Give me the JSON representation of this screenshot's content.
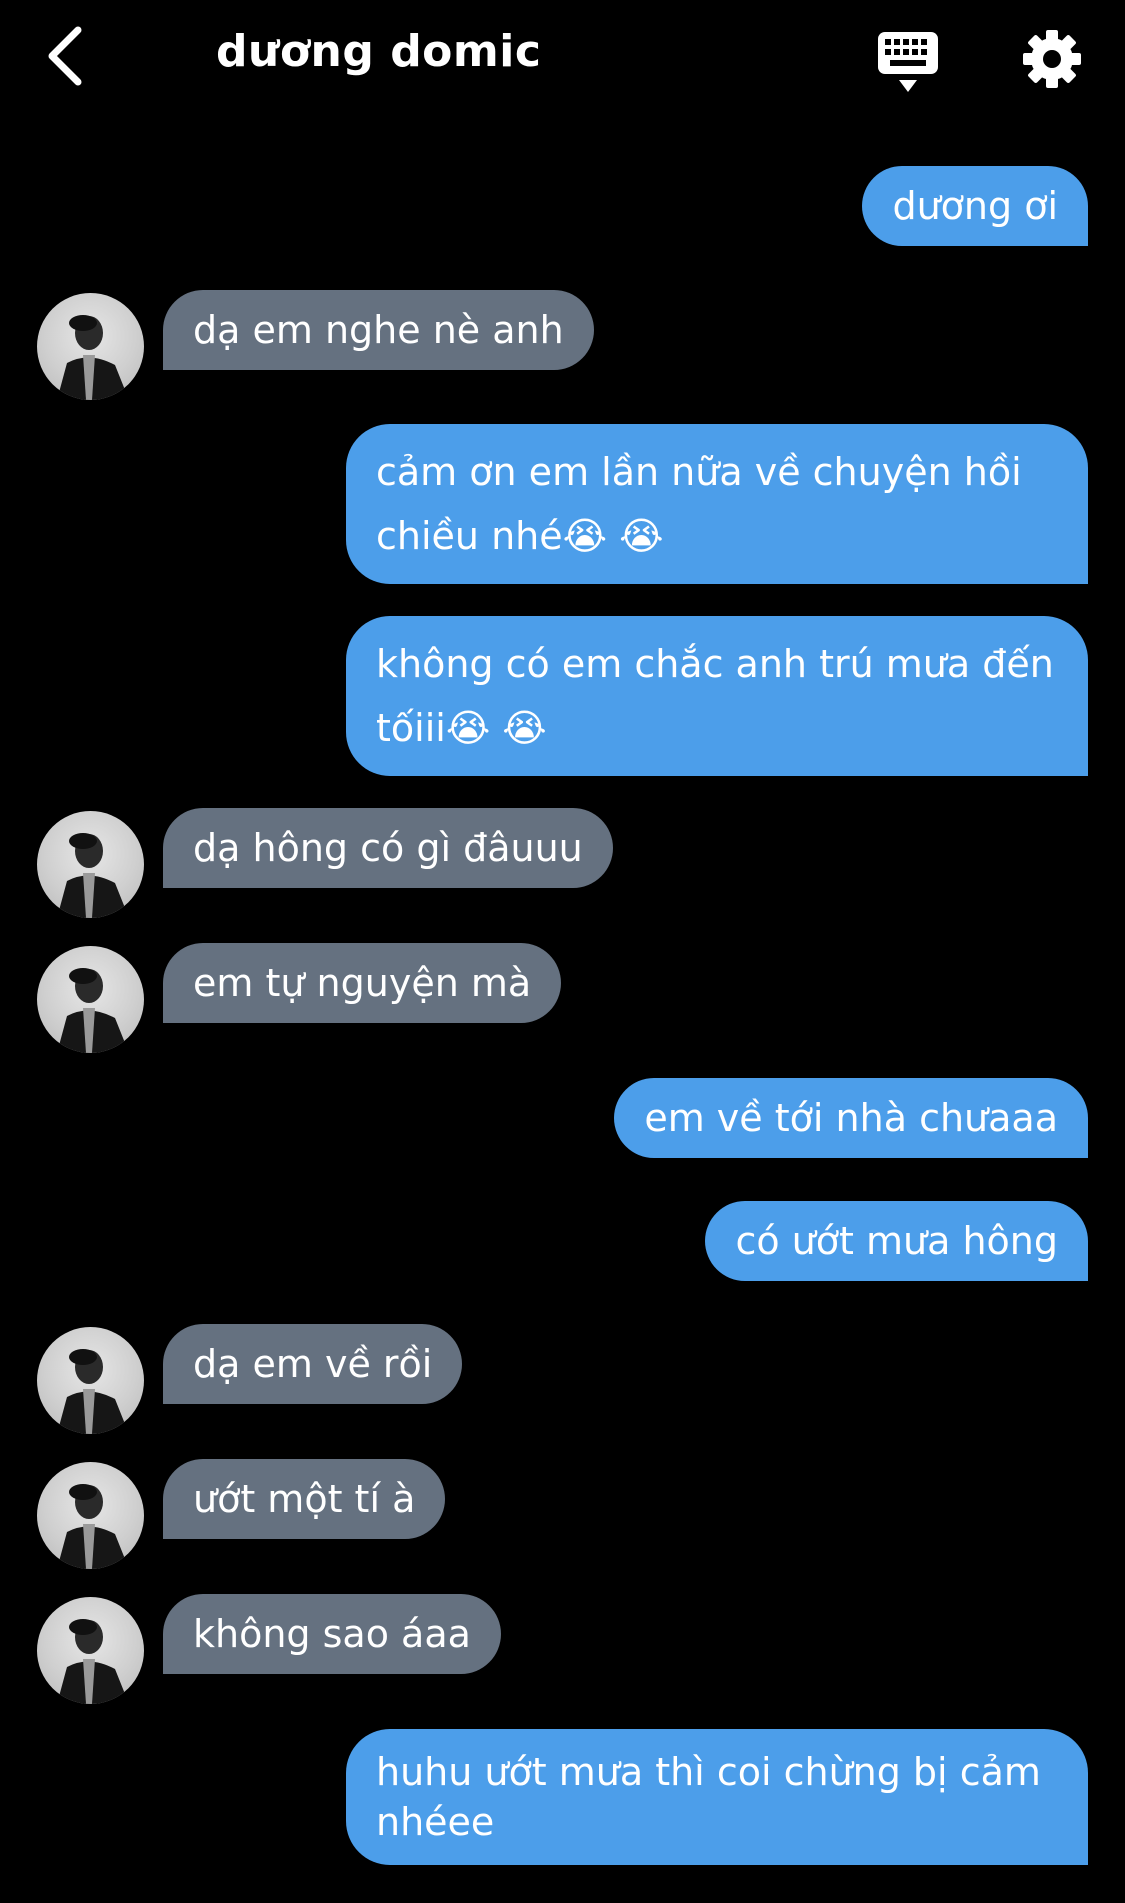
{
  "header": {
    "title": "dương domic",
    "back_icon": "chevron-left-icon",
    "keyboard_icon": "keyboard-icon",
    "settings_icon": "gear-icon"
  },
  "colors": {
    "background": "#000000",
    "sent_bubble": "#4c9eea",
    "received_bubble": "#657180"
  },
  "messages": [
    {
      "from": "me",
      "text": "dương ơi"
    },
    {
      "from": "them",
      "text": "dạ em nghe nè anh"
    },
    {
      "from": "me",
      "text": "cảm ơn em lần nữa về chuyện hồi chiều nhé😭 😭"
    },
    {
      "from": "me",
      "text": "không có em chắc anh trú mưa đến tốiii😭 😭"
    },
    {
      "from": "them",
      "text": "dạ hông có gì đâuuu"
    },
    {
      "from": "them",
      "text": "em tự nguyện mà"
    },
    {
      "from": "me",
      "text": "em về tới nhà chưaaa"
    },
    {
      "from": "me",
      "text": "có ướt mưa hông"
    },
    {
      "from": "them",
      "text": "dạ em về rồi"
    },
    {
      "from": "them",
      "text": "ướt một tí à"
    },
    {
      "from": "them",
      "text": "không sao áaa"
    },
    {
      "from": "me",
      "text": "huhu ướt mưa thì coi chừng bị cảm nhéee"
    }
  ]
}
